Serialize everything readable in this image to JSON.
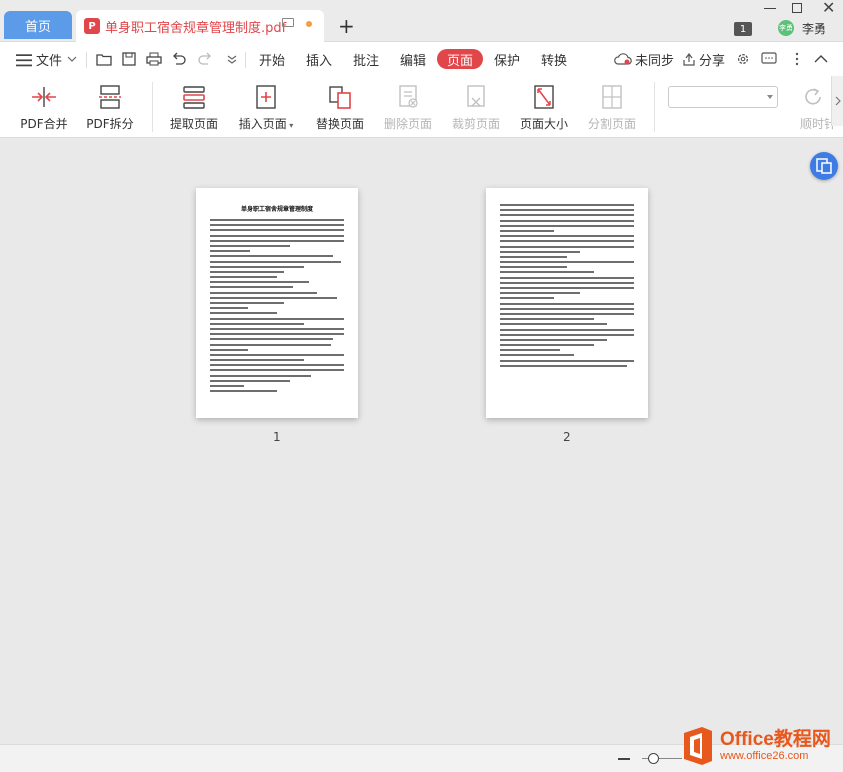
{
  "titlebar": {
    "home_tab": "首页",
    "doc_tab_icon": "P",
    "doc_tab_title": "单身职工宿舍规章管理制度.pdf",
    "badge_count": "1",
    "avatar_text": "李勇",
    "username": "李勇"
  },
  "menubar": {
    "file_label": "文件",
    "tabs": [
      {
        "label": "开始"
      },
      {
        "label": "插入"
      },
      {
        "label": "批注"
      },
      {
        "label": "编辑"
      },
      {
        "label": "页面"
      },
      {
        "label": "保护"
      },
      {
        "label": "转换"
      }
    ],
    "sync_label": "未同步",
    "share_label": "分享"
  },
  "ribbon": {
    "buttons": [
      {
        "label": "PDF合并"
      },
      {
        "label": "PDF拆分"
      },
      {
        "label": "提取页面"
      },
      {
        "label": "插入页面"
      },
      {
        "label": "替换页面"
      },
      {
        "label": "删除页面"
      },
      {
        "label": "裁剪页面"
      },
      {
        "label": "页面大小"
      },
      {
        "label": "分割页面"
      },
      {
        "label": "顺时针"
      }
    ],
    "rotate_select_value": ""
  },
  "document": {
    "page1_title": "单身职工宿舍规章管理制度",
    "pages": [
      {
        "number": "1"
      },
      {
        "number": "2"
      }
    ]
  },
  "watermark": {
    "main": "Office教程网",
    "sub": "www.office26.com"
  },
  "colors": {
    "accent_red": "#e0464a",
    "home_tab_blue": "#5b9be8",
    "float_button_blue": "#3d7ce4",
    "watermark_orange": "#e8581c"
  }
}
